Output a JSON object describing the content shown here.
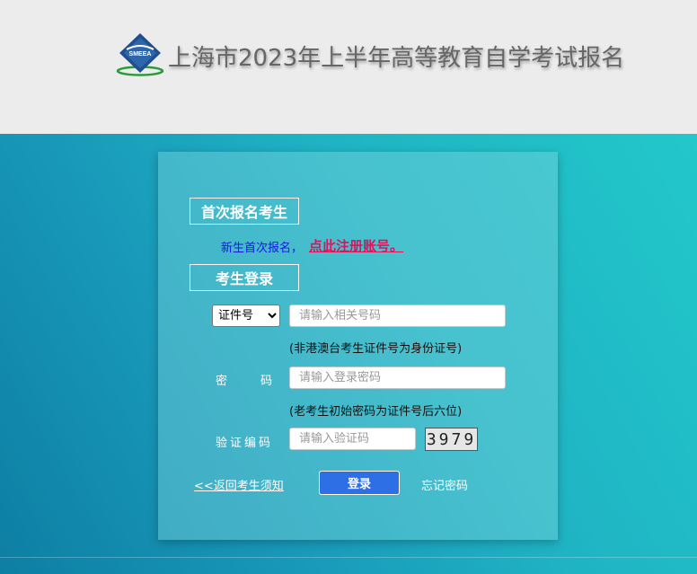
{
  "header": {
    "logo_icon": "smeea-logo-icon",
    "logo_text": "SMEEA",
    "title": "上海市2023年上半年高等教育自学考试报名"
  },
  "first_time": {
    "section_label": "首次报名考生",
    "prompt_text": "新生首次报名，",
    "register_link": "点此注册账号。"
  },
  "login": {
    "section_label": "考生登录",
    "id_type_selected": "证件号",
    "id_placeholder": "请输入相关号码",
    "id_hint": "(非港澳台考生证件号为身份证号)",
    "password_label": "密码",
    "password_placeholder": "请输入登录密码",
    "password_hint": "(老考生初始密码为证件号后六位)",
    "captcha_label": "验证编码",
    "captcha_placeholder": "请输入验证码",
    "captcha_code": "3979",
    "back_link": "<<返回考生须知",
    "login_button": "登录",
    "forgot_link": "忘记密码"
  },
  "colors": {
    "header_bg": "#ececec",
    "gradient_start": "#0d7fa3",
    "gradient_end": "#22c8ca",
    "register_link": "#e0125a",
    "prompt_text": "#1515e0",
    "login_button": "#2f6fe6"
  }
}
